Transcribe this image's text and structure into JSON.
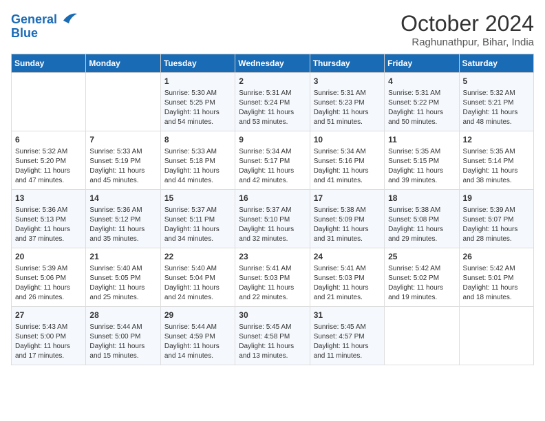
{
  "header": {
    "logo_line1": "General",
    "logo_line2": "Blue",
    "month": "October 2024",
    "location": "Raghunathpur, Bihar, India"
  },
  "days_of_week": [
    "Sunday",
    "Monday",
    "Tuesday",
    "Wednesday",
    "Thursday",
    "Friday",
    "Saturday"
  ],
  "weeks": [
    [
      {
        "day": "",
        "info": ""
      },
      {
        "day": "",
        "info": ""
      },
      {
        "day": "1",
        "info": "Sunrise: 5:30 AM\nSunset: 5:25 PM\nDaylight: 11 hours and 54 minutes."
      },
      {
        "day": "2",
        "info": "Sunrise: 5:31 AM\nSunset: 5:24 PM\nDaylight: 11 hours and 53 minutes."
      },
      {
        "day": "3",
        "info": "Sunrise: 5:31 AM\nSunset: 5:23 PM\nDaylight: 11 hours and 51 minutes."
      },
      {
        "day": "4",
        "info": "Sunrise: 5:31 AM\nSunset: 5:22 PM\nDaylight: 11 hours and 50 minutes."
      },
      {
        "day": "5",
        "info": "Sunrise: 5:32 AM\nSunset: 5:21 PM\nDaylight: 11 hours and 48 minutes."
      }
    ],
    [
      {
        "day": "6",
        "info": "Sunrise: 5:32 AM\nSunset: 5:20 PM\nDaylight: 11 hours and 47 minutes."
      },
      {
        "day": "7",
        "info": "Sunrise: 5:33 AM\nSunset: 5:19 PM\nDaylight: 11 hours and 45 minutes."
      },
      {
        "day": "8",
        "info": "Sunrise: 5:33 AM\nSunset: 5:18 PM\nDaylight: 11 hours and 44 minutes."
      },
      {
        "day": "9",
        "info": "Sunrise: 5:34 AM\nSunset: 5:17 PM\nDaylight: 11 hours and 42 minutes."
      },
      {
        "day": "10",
        "info": "Sunrise: 5:34 AM\nSunset: 5:16 PM\nDaylight: 11 hours and 41 minutes."
      },
      {
        "day": "11",
        "info": "Sunrise: 5:35 AM\nSunset: 5:15 PM\nDaylight: 11 hours and 39 minutes."
      },
      {
        "day": "12",
        "info": "Sunrise: 5:35 AM\nSunset: 5:14 PM\nDaylight: 11 hours and 38 minutes."
      }
    ],
    [
      {
        "day": "13",
        "info": "Sunrise: 5:36 AM\nSunset: 5:13 PM\nDaylight: 11 hours and 37 minutes."
      },
      {
        "day": "14",
        "info": "Sunrise: 5:36 AM\nSunset: 5:12 PM\nDaylight: 11 hours and 35 minutes."
      },
      {
        "day": "15",
        "info": "Sunrise: 5:37 AM\nSunset: 5:11 PM\nDaylight: 11 hours and 34 minutes."
      },
      {
        "day": "16",
        "info": "Sunrise: 5:37 AM\nSunset: 5:10 PM\nDaylight: 11 hours and 32 minutes."
      },
      {
        "day": "17",
        "info": "Sunrise: 5:38 AM\nSunset: 5:09 PM\nDaylight: 11 hours and 31 minutes."
      },
      {
        "day": "18",
        "info": "Sunrise: 5:38 AM\nSunset: 5:08 PM\nDaylight: 11 hours and 29 minutes."
      },
      {
        "day": "19",
        "info": "Sunrise: 5:39 AM\nSunset: 5:07 PM\nDaylight: 11 hours and 28 minutes."
      }
    ],
    [
      {
        "day": "20",
        "info": "Sunrise: 5:39 AM\nSunset: 5:06 PM\nDaylight: 11 hours and 26 minutes."
      },
      {
        "day": "21",
        "info": "Sunrise: 5:40 AM\nSunset: 5:05 PM\nDaylight: 11 hours and 25 minutes."
      },
      {
        "day": "22",
        "info": "Sunrise: 5:40 AM\nSunset: 5:04 PM\nDaylight: 11 hours and 24 minutes."
      },
      {
        "day": "23",
        "info": "Sunrise: 5:41 AM\nSunset: 5:03 PM\nDaylight: 11 hours and 22 minutes."
      },
      {
        "day": "24",
        "info": "Sunrise: 5:41 AM\nSunset: 5:03 PM\nDaylight: 11 hours and 21 minutes."
      },
      {
        "day": "25",
        "info": "Sunrise: 5:42 AM\nSunset: 5:02 PM\nDaylight: 11 hours and 19 minutes."
      },
      {
        "day": "26",
        "info": "Sunrise: 5:42 AM\nSunset: 5:01 PM\nDaylight: 11 hours and 18 minutes."
      }
    ],
    [
      {
        "day": "27",
        "info": "Sunrise: 5:43 AM\nSunset: 5:00 PM\nDaylight: 11 hours and 17 minutes."
      },
      {
        "day": "28",
        "info": "Sunrise: 5:44 AM\nSunset: 5:00 PM\nDaylight: 11 hours and 15 minutes."
      },
      {
        "day": "29",
        "info": "Sunrise: 5:44 AM\nSunset: 4:59 PM\nDaylight: 11 hours and 14 minutes."
      },
      {
        "day": "30",
        "info": "Sunrise: 5:45 AM\nSunset: 4:58 PM\nDaylight: 11 hours and 13 minutes."
      },
      {
        "day": "31",
        "info": "Sunrise: 5:45 AM\nSunset: 4:57 PM\nDaylight: 11 hours and 11 minutes."
      },
      {
        "day": "",
        "info": ""
      },
      {
        "day": "",
        "info": ""
      }
    ]
  ]
}
